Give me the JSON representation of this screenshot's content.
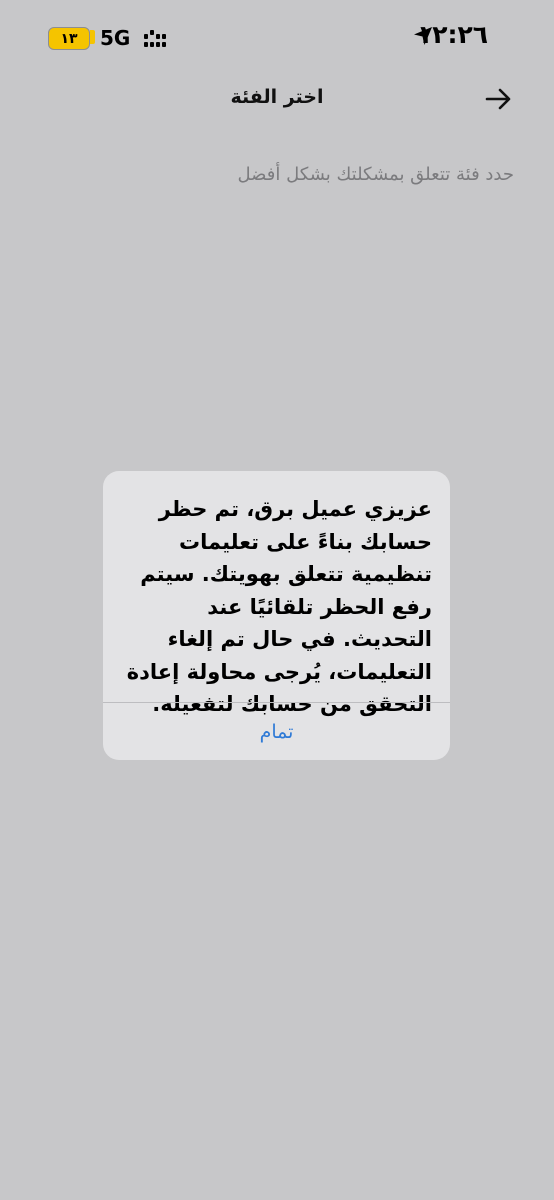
{
  "status_bar": {
    "time": "١٢:٢٦",
    "network": "5G",
    "battery": "١٣",
    "battery_color": "#f5c400"
  },
  "header": {
    "title": "اختر الفئة",
    "back_icon": "arrow-right-icon"
  },
  "subtitle": "حدد فئة تتعلق بمشكلتك بشكل أفضل",
  "alert": {
    "message": "عزيزي عميل برق، تم حظر حسابك بناءً على تعليمات تنظيمية تتعلق بهويتك. سيتم رفع الحظر تلقائيًا عند التحديث. في حال تم إلغاء التعليمات، يُرجى محاولة إعادة التحقق من حسابك لتفعيله.",
    "ok_label": "تمام",
    "ok_color": "#2f7ad6"
  }
}
